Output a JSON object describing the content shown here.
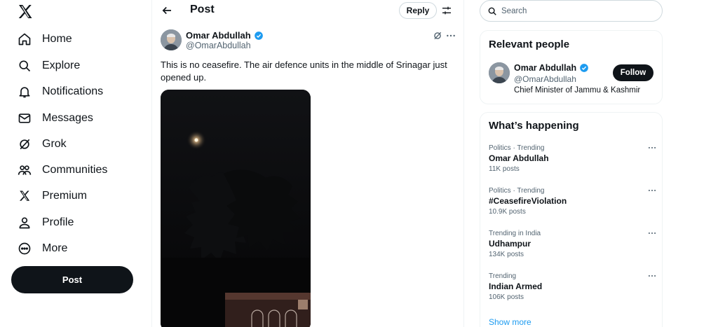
{
  "nav": {
    "items": [
      {
        "label": "Home",
        "icon": "home-icon"
      },
      {
        "label": "Explore",
        "icon": "search-icon"
      },
      {
        "label": "Notifications",
        "icon": "bell-icon"
      },
      {
        "label": "Messages",
        "icon": "envelope-icon"
      },
      {
        "label": "Grok",
        "icon": "grok-icon"
      },
      {
        "label": "Communities",
        "icon": "communities-icon"
      },
      {
        "label": "Premium",
        "icon": "x-logo-icon"
      },
      {
        "label": "Profile",
        "icon": "person-icon"
      },
      {
        "label": "More",
        "icon": "more-circle-icon"
      }
    ],
    "post_label": "Post"
  },
  "header": {
    "title": "Post",
    "reply_label": "Reply"
  },
  "tweet": {
    "author_name": "Omar Abdullah",
    "author_handle": "@OmarAbdullah",
    "text": "This is no ceasefire. The air defence units in the middle of Srinagar just opened up."
  },
  "search": {
    "placeholder": "Search"
  },
  "relevant_people": {
    "title": "Relevant people",
    "name": "Omar Abdullah",
    "handle": "@OmarAbdullah",
    "bio": "Chief Minister of Jammu & Kashmir",
    "follow_label": "Follow"
  },
  "whats_happening": {
    "title": "What’s happening",
    "trends": [
      {
        "context": "Politics · Trending",
        "name": "Omar Abdullah",
        "count": "11K posts"
      },
      {
        "context": "Politics · Trending",
        "name": "#CeasefireViolation",
        "count": "10.9K posts"
      },
      {
        "context": "Trending in India",
        "name": "Udhampur",
        "count": "134K posts"
      },
      {
        "context": "Trending",
        "name": "Indian Armed",
        "count": "106K posts"
      }
    ],
    "show_more": "Show more"
  },
  "colors": {
    "accent": "#1d9bf0",
    "text": "#0f1419",
    "secondary": "#536471",
    "border": "#eff3f4"
  }
}
